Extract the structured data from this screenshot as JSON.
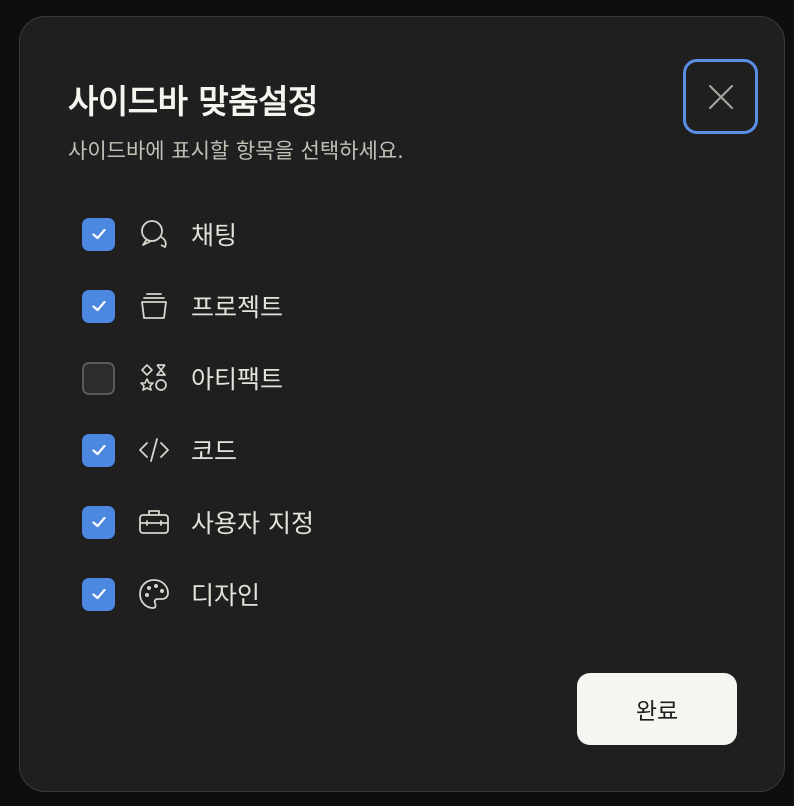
{
  "dialog": {
    "title": "사이드바 맞춤설정",
    "subtitle": "사이드바에 표시할 항목을 선택하세요.",
    "close_icon": "close-icon",
    "done_label": "완료"
  },
  "items": [
    {
      "label": "채팅",
      "checked": true,
      "icon": "chat-bubbles-icon"
    },
    {
      "label": "프로젝트",
      "checked": true,
      "icon": "folder-stack-icon"
    },
    {
      "label": "아티팩트",
      "checked": false,
      "icon": "shapes-icon"
    },
    {
      "label": "코드",
      "checked": true,
      "icon": "code-icon"
    },
    {
      "label": "사용자 지정",
      "checked": true,
      "icon": "toolbox-icon"
    },
    {
      "label": "디자인",
      "checked": true,
      "icon": "palette-icon"
    }
  ],
  "colors": {
    "accent": "#4c87e0",
    "focus_ring": "#5a8fe6",
    "dialog_background": "#1f1f1f",
    "page_background": "#0e0e0e"
  }
}
